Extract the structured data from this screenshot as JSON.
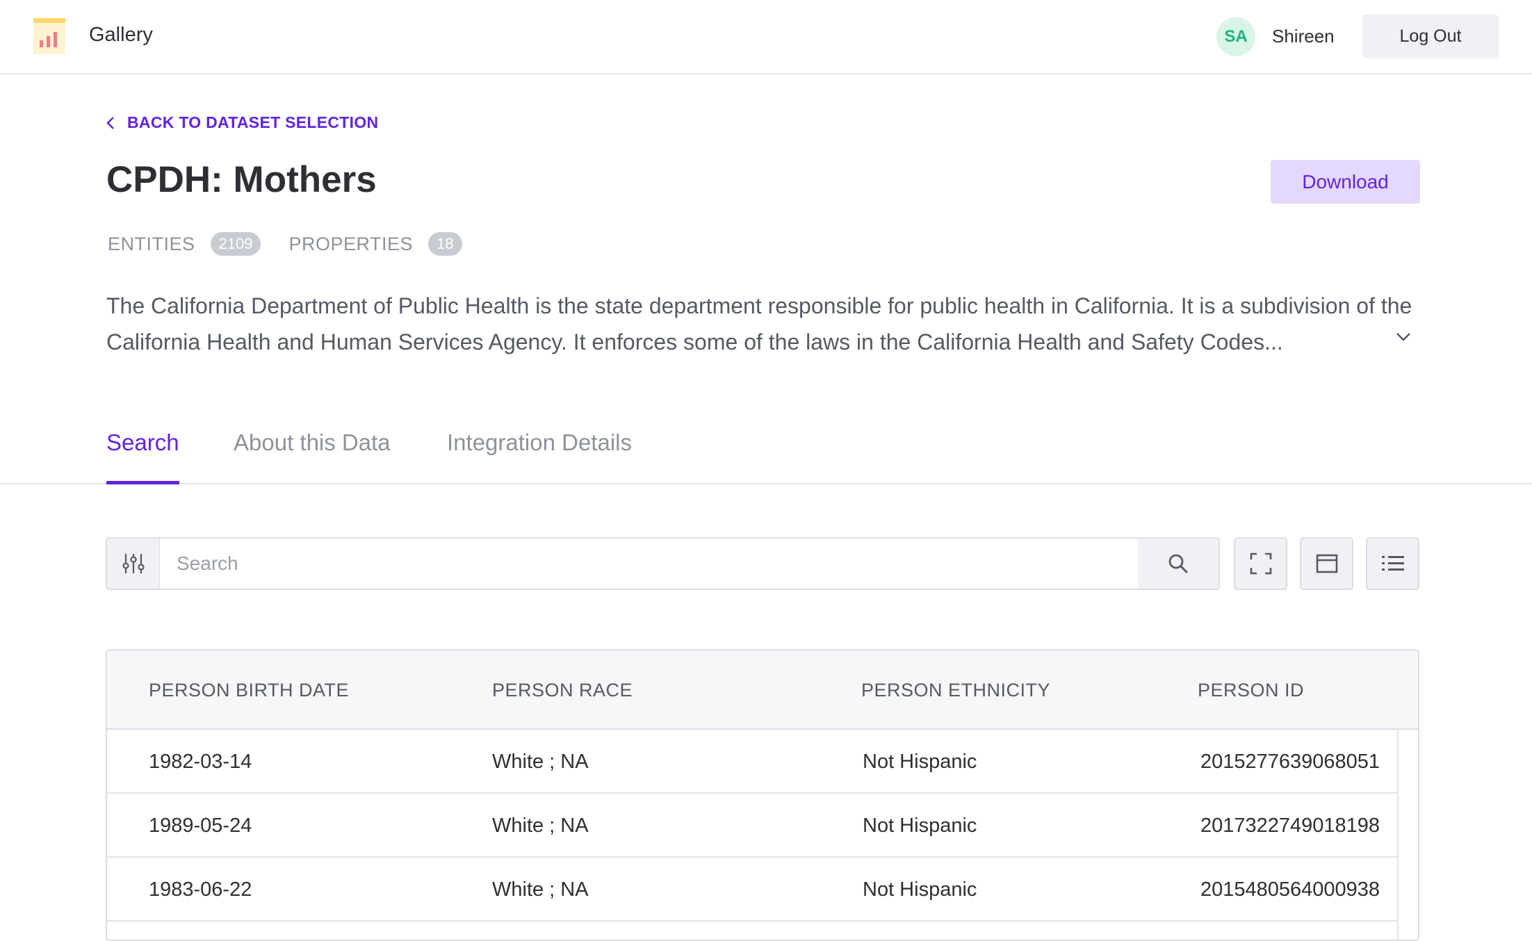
{
  "header": {
    "app_name": "Gallery",
    "avatar_initials": "SA",
    "username": "Shireen",
    "logout_label": "Log Out"
  },
  "back_link": "BACK TO DATASET SELECTION",
  "dataset": {
    "title": "CPDH: Mothers",
    "download_label": "Download",
    "entities_label": "ENTITIES",
    "entities_count": "2109",
    "properties_label": "PROPERTIES",
    "properties_count": "18",
    "description": "The California Department of Public Health is the state department responsible for public health in California. It is a subdivision of the California Health and Human Services Agency. It enforces some of the laws in the California Health and Safety Codes..."
  },
  "tabs": [
    {
      "label": "Search",
      "active": true
    },
    {
      "label": "About this Data",
      "active": false
    },
    {
      "label": "Integration Details",
      "active": false
    }
  ],
  "search": {
    "placeholder": "Search",
    "value": ""
  },
  "table": {
    "columns": [
      "PERSON BIRTH DATE",
      "PERSON RACE",
      "PERSON ETHNICITY",
      "PERSON ID"
    ],
    "rows": [
      [
        "1982-03-14",
        "White ; NA",
        "Not Hispanic",
        "2015277639068051"
      ],
      [
        "1989-05-24",
        "White ; NA",
        "Not Hispanic",
        "2017322749018198"
      ],
      [
        "1983-06-22",
        "White ; NA",
        "Not Hispanic",
        "2015480564000938"
      ]
    ]
  },
  "colors": {
    "accent": "#6124e2",
    "accent_light": "#e4d8ff",
    "avatar_bg": "#d9f5e8",
    "avatar_text": "#1fb47a"
  },
  "icons": {
    "logo": "gallery-logo-icon",
    "back": "chevron-left-icon",
    "expand": "chevron-down-icon",
    "filter": "sliders-icon",
    "search": "search-icon",
    "fullscreen": "expand-icon",
    "layout": "window-icon",
    "list": "list-icon"
  }
}
